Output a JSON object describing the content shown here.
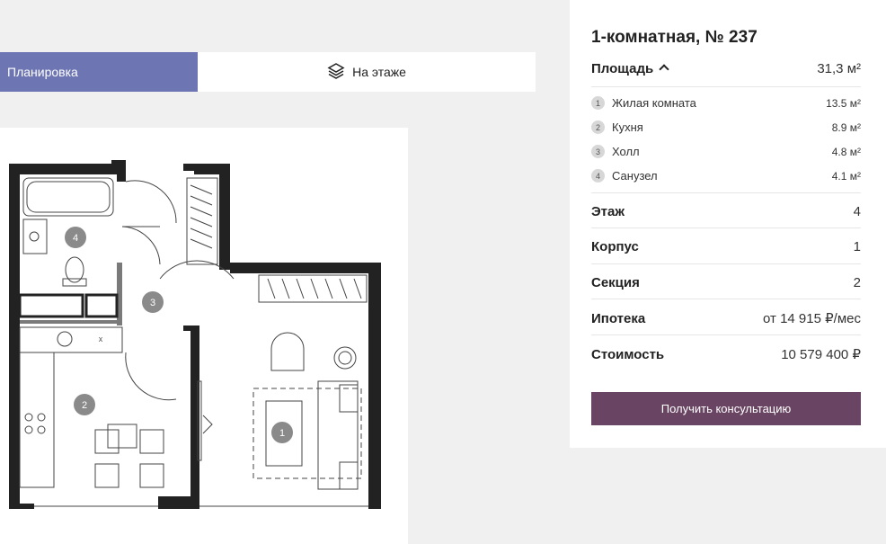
{
  "tabs": {
    "plan_label": "Планировка",
    "floor_label": "На этаже"
  },
  "apartment": {
    "title": "1-комнатная, № 237",
    "area_label": "Площадь",
    "area_value": "31,3 м²",
    "rooms": [
      {
        "num": "1",
        "name": "Жилая комната",
        "area": "13.5 м²"
      },
      {
        "num": "2",
        "name": "Кухня",
        "area": "8.9 м²"
      },
      {
        "num": "3",
        "name": "Холл",
        "area": "4.8 м²"
      },
      {
        "num": "4",
        "name": "Санузел",
        "area": "4.1 м²"
      }
    ],
    "floor_label": "Этаж",
    "floor_value": "4",
    "building_label": "Корпус",
    "building_value": "1",
    "section_label": "Секция",
    "section_value": "2",
    "mortgage_label": "Ипотека",
    "mortgage_value": "от 14 915 ₽/мес",
    "price_label": "Стоимость",
    "price_value": "10 579 400 ₽",
    "cta_label": "Получить консультацию"
  },
  "plan_labels": [
    "1",
    "2",
    "3",
    "4",
    "x"
  ],
  "colors": {
    "tab_active": "#6d75b3",
    "cta": "#6a4563",
    "background": "#f0f0f0"
  }
}
